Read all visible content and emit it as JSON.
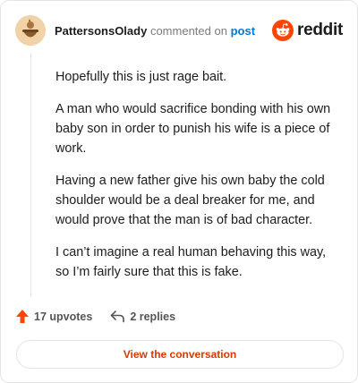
{
  "comment": {
    "username": "PattersonsOlady",
    "commented_text": "commented on",
    "post_link": "post",
    "paragraphs": [
      "Hopefully this is just rage bait.",
      "A man who would sacrifice bonding with his own baby son in order to punish his wife is a piece of work.",
      "Having a new father give his own baby the cold shoulder would be a deal breaker for me, and would prove that the man is of bad character.",
      "I can’t imagine a real human behaving this way, so I’m fairly sure that this is fake."
    ]
  },
  "brand": {
    "name": "reddit",
    "icon": "reddit-snoo-icon"
  },
  "actions": {
    "upvotes": "17 upvotes",
    "upvote_icon": "upvote-arrow-icon",
    "replies": "2 replies",
    "reply_icon": "reply-arrow-icon"
  },
  "cta": {
    "label": "View the conversation"
  },
  "colors": {
    "accent": "#ff4500",
    "link": "#0079d3",
    "cta": "#d93a00"
  }
}
